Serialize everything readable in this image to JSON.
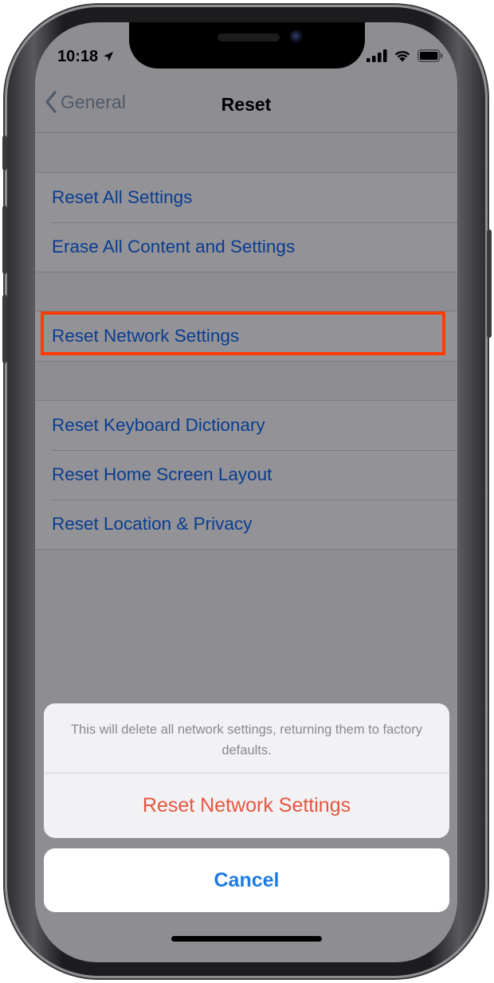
{
  "status_bar": {
    "time": "10:18",
    "icons": [
      "location-arrow-icon",
      "cellular-signal-icon",
      "wifi-icon",
      "battery-icon"
    ]
  },
  "nav": {
    "back_label": "General",
    "title": "Reset"
  },
  "groups": [
    {
      "items": [
        "Reset All Settings",
        "Erase All Content and Settings"
      ]
    },
    {
      "items": [
        "Reset Network Settings"
      ]
    },
    {
      "items": [
        "Reset Keyboard Dictionary",
        "Reset Home Screen Layout",
        "Reset Location & Privacy"
      ]
    }
  ],
  "action_sheet": {
    "message": "This will delete all network settings, returning them to factory defaults.",
    "destructive_label": "Reset Network Settings",
    "cancel_label": "Cancel"
  },
  "colors": {
    "link_blue": "#0a3d8f",
    "destructive_red": "#e8553f",
    "cancel_blue": "#1e7be0",
    "highlight_orange": "#ff3b00",
    "dimmed_background": "#8e8d92"
  }
}
